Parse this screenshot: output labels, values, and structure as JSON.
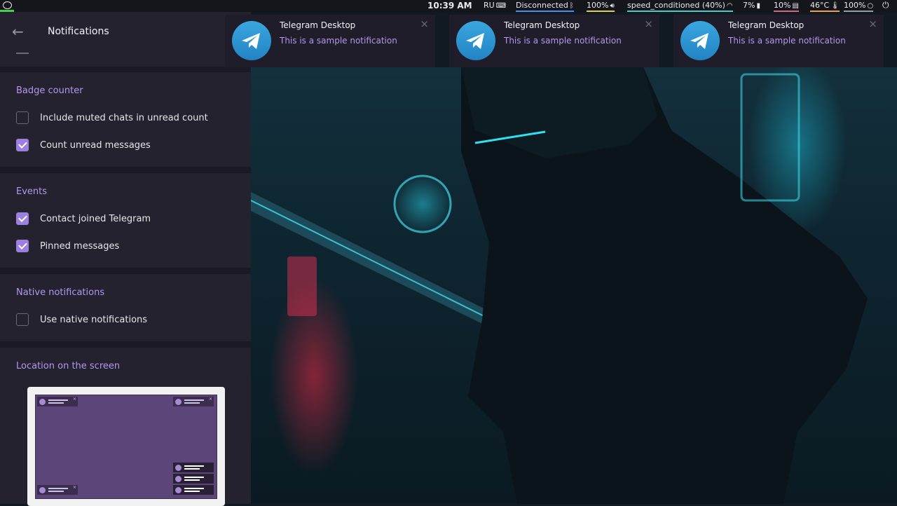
{
  "topbar": {
    "clock": "10:39 AM",
    "keyboard": "RU",
    "bluetooth": "Disconnected",
    "volume": "100%",
    "wifi": "speed_conditioned (40%)",
    "cpu": "7%",
    "memory": "10%",
    "temperature": "46°C",
    "battery": "100%",
    "icons": [
      "chat-bubble-icon",
      "keyboard-icon",
      "bluetooth-icon",
      "speaker-icon",
      "wifi-icon",
      "cpu-icon",
      "memory-icon",
      "thermometer-icon",
      "battery-icon",
      "power-icon"
    ],
    "accent_colors": {
      "launcher": "#3fd24a",
      "clock": "#ffffff",
      "bluetooth": "#4a8cf0",
      "volume": "#e0d23a",
      "wifi": "#3fd2c4",
      "memory": "#e06080",
      "temp": "#f0a040"
    }
  },
  "settings": {
    "title": "Notifications",
    "sections": [
      {
        "title": "Badge counter",
        "items": [
          {
            "label": "Include muted chats in unread count",
            "checked": false
          },
          {
            "label": "Count unread messages",
            "checked": true
          }
        ]
      },
      {
        "title": "Events",
        "items": [
          {
            "label": "Contact joined Telegram",
            "checked": true
          },
          {
            "label": "Pinned messages",
            "checked": true
          }
        ]
      },
      {
        "title": "Native notifications",
        "items": [
          {
            "label": "Use native notifications",
            "checked": false
          }
        ]
      },
      {
        "title": "Location on the screen"
      }
    ],
    "accent": "#b497f0"
  },
  "notifications": [
    {
      "app": "Telegram Desktop",
      "message": "This is a sample notification"
    },
    {
      "app": "Telegram Desktop",
      "message": "This is a sample notification"
    },
    {
      "app": "Telegram Desktop",
      "message": "This is a sample notification"
    }
  ]
}
